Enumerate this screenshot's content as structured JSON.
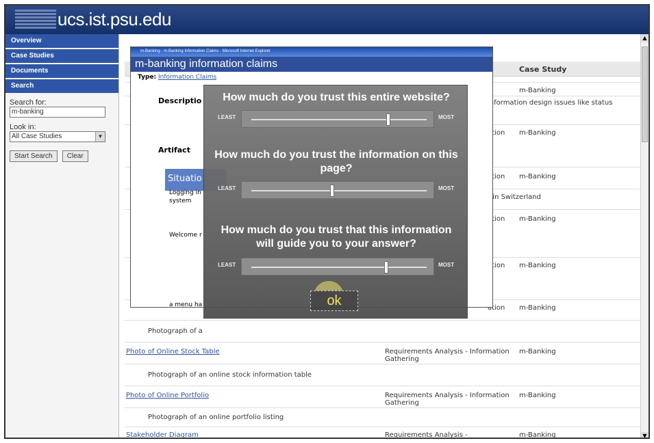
{
  "header": {
    "site_title": "ucs.ist.psu.edu"
  },
  "nav": {
    "items": [
      "Overview",
      "Case Studies",
      "Documents",
      "Search"
    ]
  },
  "search": {
    "search_for_label": "Search for:",
    "search_value": "m-banking",
    "look_in_label": "Look in:",
    "look_in_value": "All Case Studies",
    "start_button": "Start Search",
    "clear_button": "Clear"
  },
  "table": {
    "header_case": "Case Study",
    "rows": [
      {
        "case": "m-Banking"
      },
      {
        "type": "information design issues like status"
      },
      {
        "type": "ation",
        "case": "m-Banking"
      },
      {
        "type": "ation",
        "case": "m-Banking"
      },
      {
        "type": "r in Switzerland"
      },
      {
        "type": "ation",
        "case": "m-Banking"
      },
      {
        "type": "ation",
        "case": "m-Banking"
      },
      {
        "type": "ation",
        "case": "m-Banking"
      },
      {
        "desc": "Photograph of a"
      }
    ],
    "bottom_rows": [
      {
        "title": "Photo of Online Stock Table",
        "type": "Requirements Analysis - Information Gathering",
        "case": "m-Banking",
        "desc": "Photograph of an online stock information table"
      },
      {
        "title": "Photo of Online Portfolio",
        "type": "Requirements Analysis - Information Gathering",
        "case": "m-Banking",
        "desc": "Photograph of an online portfolio listing"
      },
      {
        "title": "Stakeholder Diagram",
        "type": "Requirements Analysis - Interpretation",
        "case": "m-Banking"
      }
    ]
  },
  "popup": {
    "title_bar": "m-Banking - m-Banking Information Claims - Microsoft Internet Explorer",
    "heading_prefix": "m-banking",
    "heading_main": "m-banking information claims",
    "type_label": "Type:",
    "type_link": "Information Claims",
    "description_label": "Descriptio",
    "artifact_label": "Artifact",
    "situation_label": "Situatio",
    "logging_in": "Logging in",
    "system": "system",
    "welcome": "Welcome r",
    "menu_text": "a menu ha"
  },
  "overlay": {
    "q1": "How much do you trust this entire website?",
    "q2": "How much do you trust the information on this page?",
    "q3": "How much do you trust that this information will guide you to your answer?",
    "least": "LEAST",
    "most": "MOST",
    "ok": "ok",
    "slider_values": [
      0.78,
      0.46,
      0.77
    ]
  }
}
